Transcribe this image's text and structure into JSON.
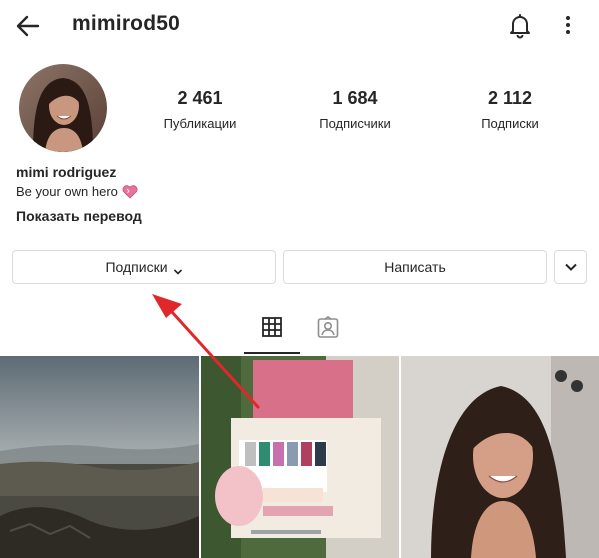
{
  "header": {
    "username": "mimirod50"
  },
  "stats": {
    "posts": {
      "value": "2 461",
      "label": "Публикации"
    },
    "followers": {
      "value": "1 684",
      "label": "Подписчики"
    },
    "following": {
      "value": "2 112",
      "label": "Подписки"
    }
  },
  "bio": {
    "name": "mimi rodriguez",
    "text": "Be your own hero",
    "translate": "Показать перевод"
  },
  "buttons": {
    "following": "Подписки",
    "message": "Написать"
  },
  "posts": [
    "landscape photo",
    "nail polish kit photo",
    "selfie photo"
  ],
  "colors": {
    "annotation_arrow": "#e0282c",
    "heart": "#e8739a"
  }
}
